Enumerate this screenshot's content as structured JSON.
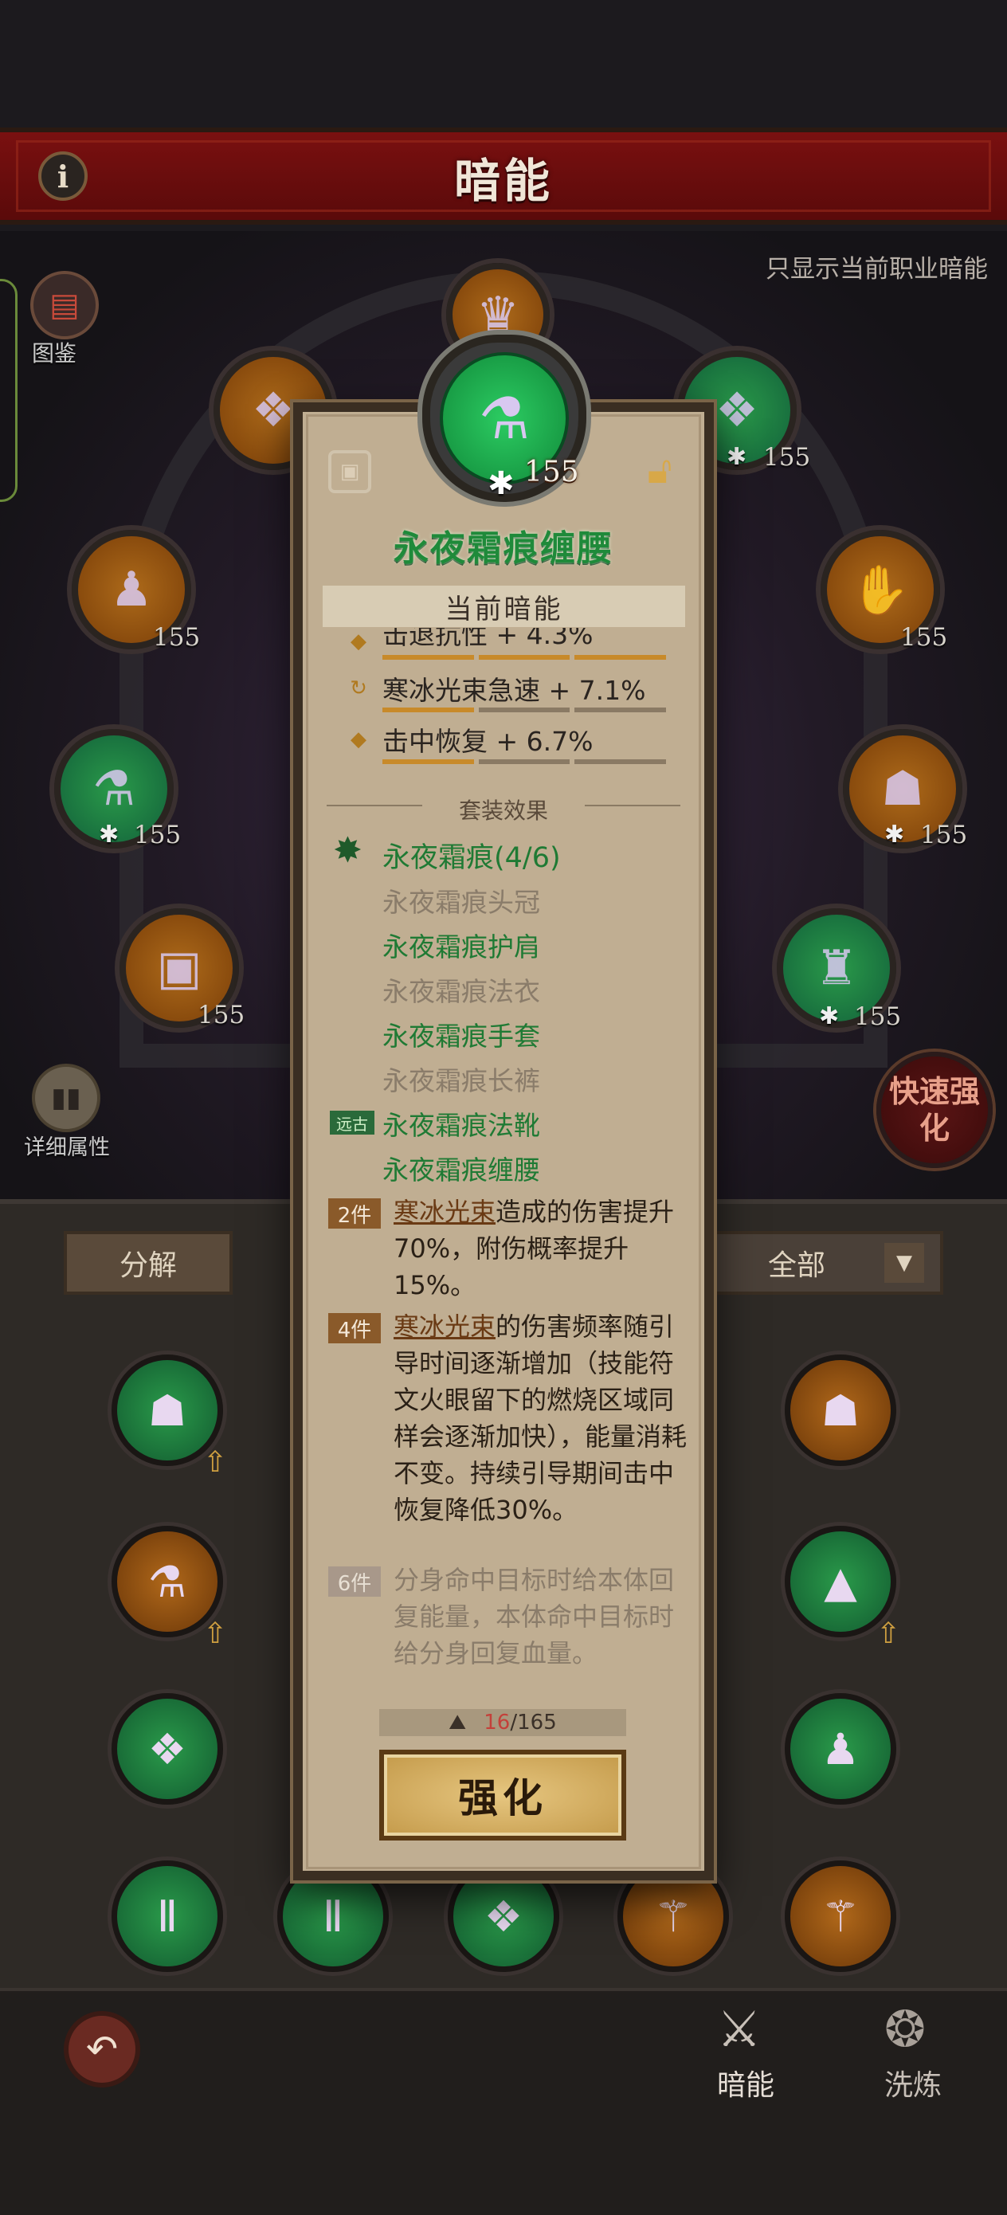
{
  "header": {
    "title": "暗能",
    "info_icon": "i",
    "hint": "只显示当前职业暗能"
  },
  "scene": {
    "atlas_label": "图鉴",
    "detail_label": "详细属性",
    "quick_enhance": "快速强化",
    "slots": [
      {
        "level": "155",
        "star": "✱"
      },
      {
        "level": "155",
        "star": "✱"
      },
      {
        "level": "155",
        "star": ""
      },
      {
        "level": "155",
        "star": ""
      },
      {
        "level": "155",
        "star": "✱"
      },
      {
        "level": "155",
        "star": "✱"
      },
      {
        "level": "155",
        "star": ""
      },
      {
        "level": "155",
        "star": "✱"
      }
    ]
  },
  "inventory": {
    "decompose": "分解",
    "filter": "全部"
  },
  "nav": {
    "dark_energy": "暗能",
    "refine": "洗炼"
  },
  "card": {
    "level": "155",
    "star": "✱",
    "item_name": "永夜霜痕缠腰",
    "section_current": "当前暗能",
    "stats": [
      {
        "text": "击退抗性 + 4.3%",
        "fill": 1
      },
      {
        "text": "寒冰光束急速 + 7.1%",
        "fill": 1
      },
      {
        "text": "击中恢复 + 6.7%",
        "fill": 1
      }
    ],
    "set_header": "套装效果",
    "set_title": "永夜霜痕(4/6)",
    "set_items": [
      {
        "name": "永夜霜痕头冠",
        "owned": false
      },
      {
        "name": "永夜霜痕护肩",
        "owned": true
      },
      {
        "name": "永夜霜痕法衣",
        "owned": false
      },
      {
        "name": "永夜霜痕手套",
        "owned": true
      },
      {
        "name": "永夜霜痕长裤",
        "owned": false
      },
      {
        "name": "永夜霜痕法靴",
        "owned": true
      },
      {
        "name": "永夜霜痕缠腰",
        "owned": true
      }
    ],
    "ancient_badge": "远古",
    "tiers": [
      {
        "badge": "2件",
        "skill": "寒冰光束",
        "rest": "造成的伤害提升70%，附伤概率提升15%。"
      },
      {
        "badge": "4件",
        "skill": "寒冰光束",
        "rest": "的伤害频率随引导时间逐渐增加（技能符文火眼留下的燃烧区域同样会逐渐加快），能量消耗不变。持续引导期间击中恢复降低30%。"
      },
      {
        "badge": "6件",
        "skill": "",
        "rest": "分身命中目标时给本体回复能量，本体命中目标时给分身回复血量。"
      }
    ],
    "material_have": "16",
    "material_need": "/165",
    "enhance": "强化"
  }
}
